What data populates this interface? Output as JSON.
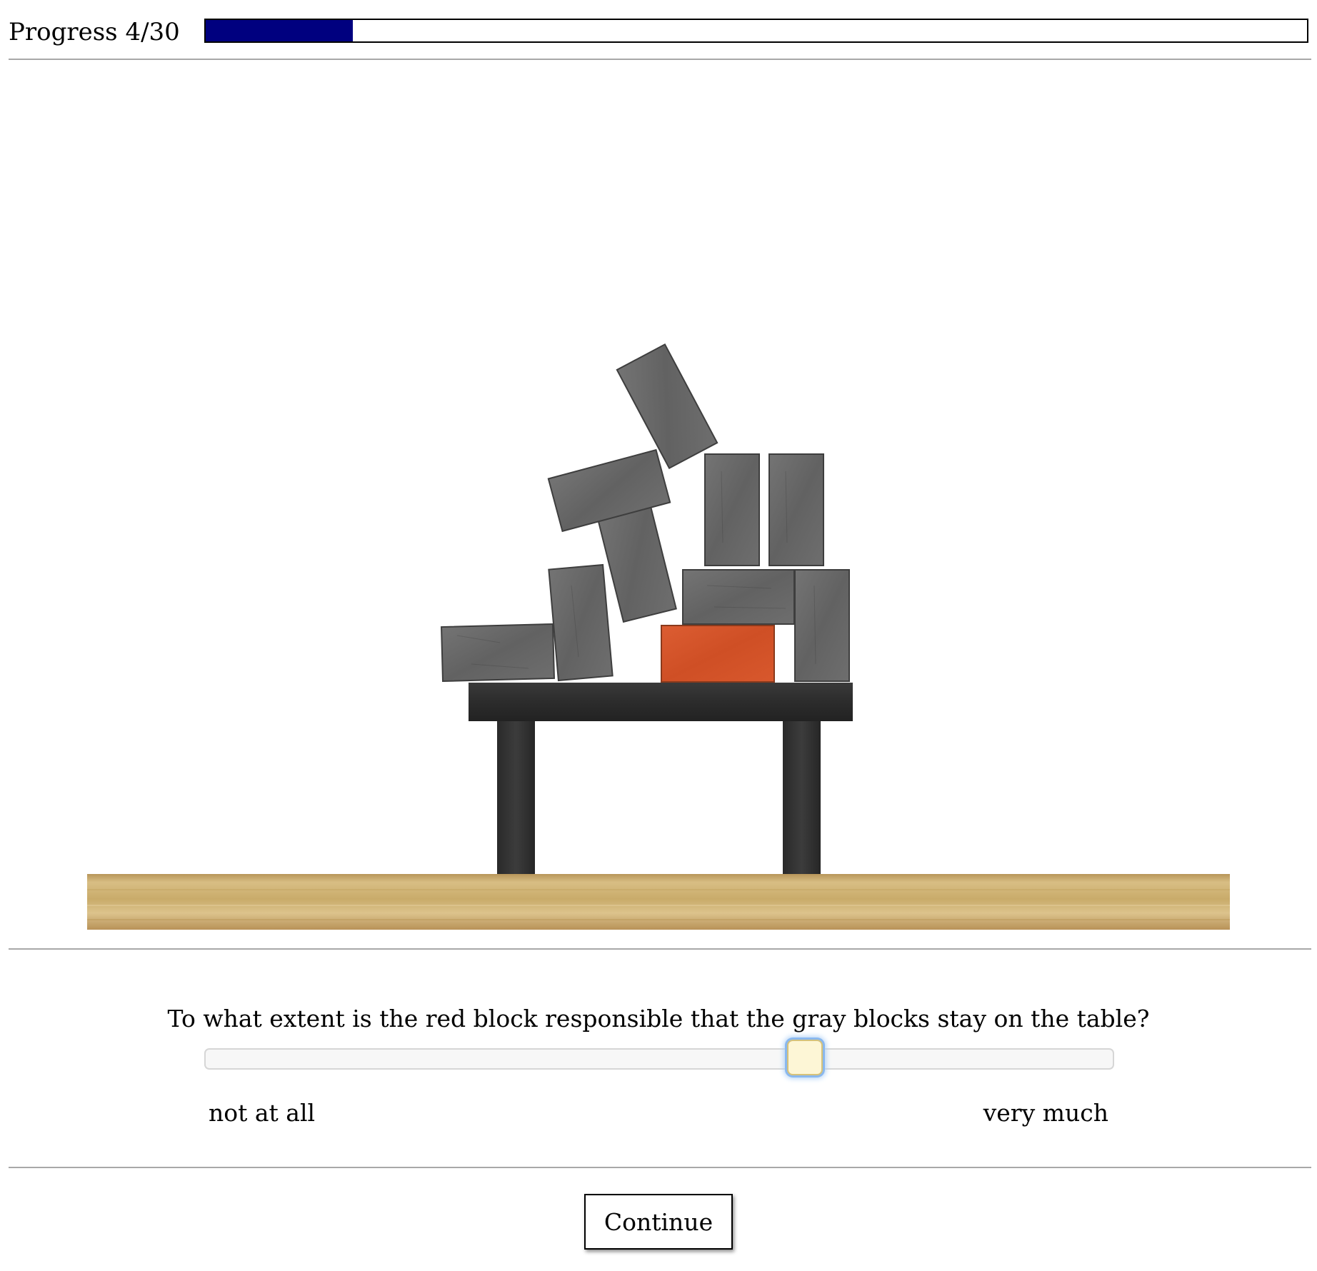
{
  "progress": {
    "label": "Progress 4/30",
    "current": 4,
    "total": 30,
    "fill_color": "#00007f"
  },
  "scene": {
    "red_block_color": "#d4532a",
    "gray_block_color": "#6b6b6b",
    "table_color": "#2e2e2e",
    "ground_color": "#c9ab6a"
  },
  "question": {
    "text": "To what extent is the red block responsible that the gray blocks stay on the table?",
    "slider_value": 0.66,
    "label_min": "not at all",
    "label_max": "very much"
  },
  "continue_button": {
    "label": "Continue"
  }
}
